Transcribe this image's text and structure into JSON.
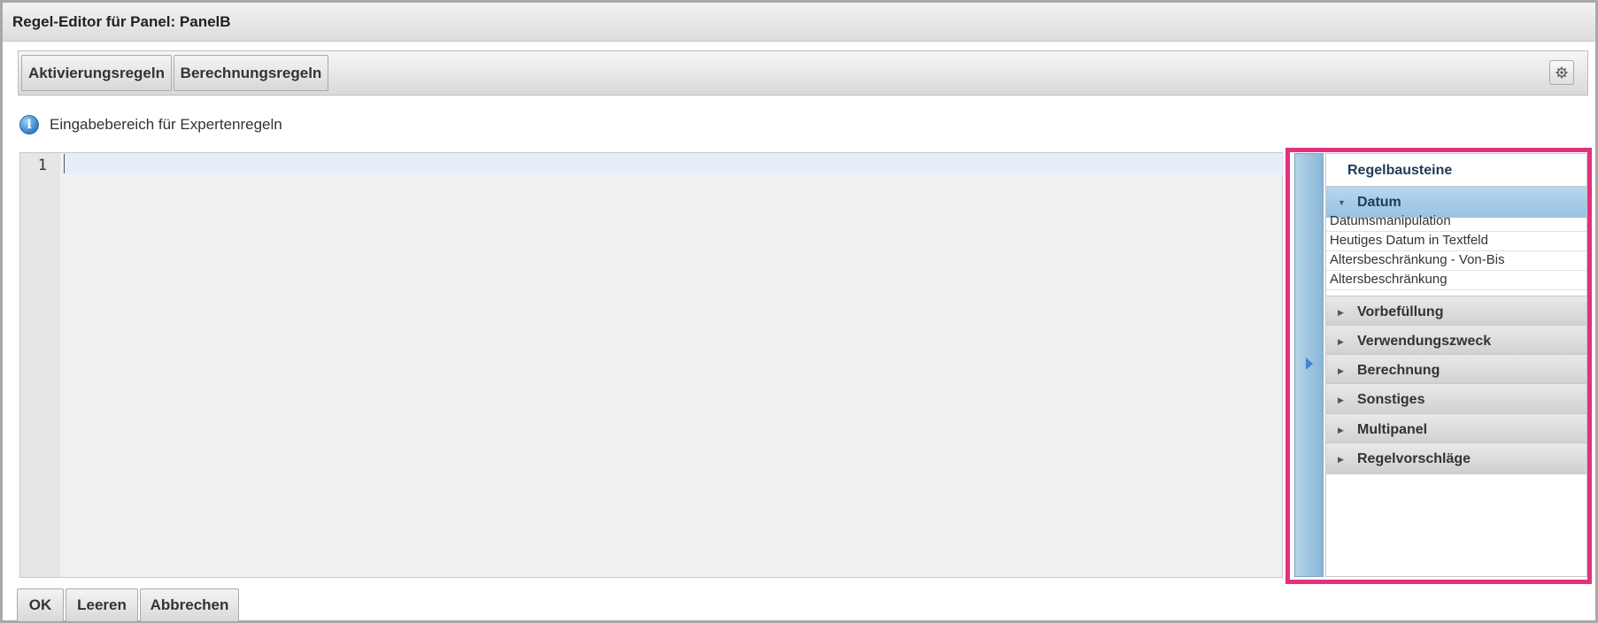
{
  "window": {
    "title": "Regel-Editor für Panel: PanelB"
  },
  "toolbar": {
    "tabs": [
      {
        "label": "Aktivierungsregeln"
      },
      {
        "label": "Berechnungsregeln"
      }
    ],
    "settings_icon": "gear-icon"
  },
  "info": {
    "text": "Eingabebereich für Expertenregeln",
    "icon": "info-icon"
  },
  "editor": {
    "line_numbers": [
      "1"
    ],
    "content": ""
  },
  "rules_panel": {
    "title": "Regelbausteine",
    "groups": [
      {
        "label": "Datum",
        "expanded": true,
        "items": [
          "Datumsmanipulation",
          "Heutiges Datum in Textfeld",
          "Altersbeschränkung - Von-Bis",
          "Altersbeschränkung"
        ]
      },
      {
        "label": "Vorbefüllung",
        "expanded": false
      },
      {
        "label": "Verwendungszweck",
        "expanded": false
      },
      {
        "label": "Berechnung",
        "expanded": false
      },
      {
        "label": "Sonstiges",
        "expanded": false
      },
      {
        "label": "Multipanel",
        "expanded": false
      },
      {
        "label": "Regelvorschläge",
        "expanded": false
      }
    ]
  },
  "footer": {
    "ok_label": "OK",
    "clear_label": "Leeren",
    "cancel_label": "Abbrechen"
  },
  "colors": {
    "highlight": "#e2317e",
    "accent": "#3b88cf"
  }
}
